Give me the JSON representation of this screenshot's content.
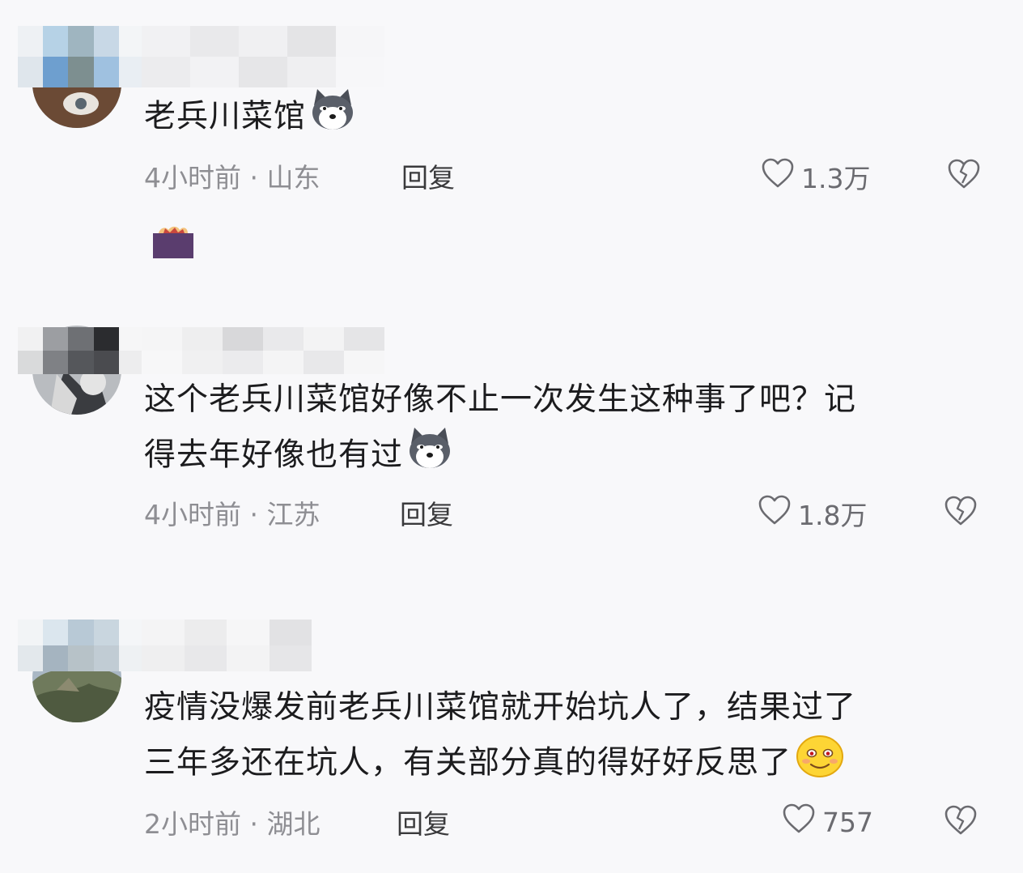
{
  "comments": [
    {
      "text_lines": [
        "老兵川菜馆"
      ],
      "emoji": "husky-emoji-icon",
      "time": "4小时前",
      "location": "山东",
      "meta_separator": "·",
      "reply_label": "回复",
      "likes": "1.3万"
    },
    {
      "text_lines": [
        "这个老兵川菜馆好像不止一次发生这种事了吧？记",
        "得去年好像也有过"
      ],
      "emoji": "husky-emoji-icon",
      "time": "4小时前",
      "location": "江苏",
      "meta_separator": "·",
      "reply_label": "回复",
      "likes": "1.8万"
    },
    {
      "text_lines": [
        "疫情没爆发前老兵川菜馆就开始坑人了，结果过了",
        "三年多还在坑人，有关部分真的得好好反思了"
      ],
      "emoji": "smile-emoji-icon",
      "time": "2小时前",
      "location": "湖北",
      "meta_separator": "·",
      "reply_label": "回复",
      "likes": "757"
    }
  ],
  "colors": {
    "background": "#f8f8fa",
    "text": "#1c1c1e",
    "meta": "#8e8e93"
  }
}
